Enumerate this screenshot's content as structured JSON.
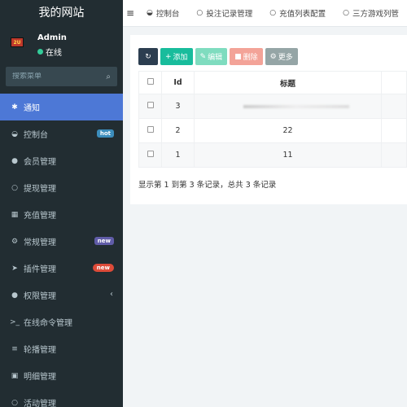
{
  "site": {
    "title": "我的网站"
  },
  "user": {
    "name": "Admin",
    "status": "在线",
    "avatar_text": "2U"
  },
  "search": {
    "placeholder": "搜索菜单"
  },
  "menu": [
    {
      "label": "通知",
      "icon": "asterisk-icon"
    },
    {
      "label": "控制台",
      "icon": "dashboard-icon",
      "badge": "hot"
    },
    {
      "label": "会员管理",
      "icon": "users-icon"
    },
    {
      "label": "提现管理",
      "icon": "circle-icon"
    },
    {
      "label": "充值管理",
      "icon": "grid-icon"
    },
    {
      "label": "常规管理",
      "icon": "cogs-icon",
      "badge": "new"
    },
    {
      "label": "插件管理",
      "icon": "rocket-icon",
      "badge": "new"
    },
    {
      "label": "权限管理",
      "icon": "group-icon"
    },
    {
      "label": "在线命令管理",
      "icon": "terminal-icon"
    },
    {
      "label": "轮播管理",
      "icon": "list-icon"
    },
    {
      "label": "明细管理",
      "icon": "calendar-icon"
    },
    {
      "label": "活动管理",
      "icon": "circle-icon"
    }
  ],
  "tabs": [
    {
      "label": "控制台"
    },
    {
      "label": "投注记录管理"
    },
    {
      "label": "充值列表配置"
    },
    {
      "label": "三方游戏列管"
    }
  ],
  "toolbar": {
    "add": "添加",
    "edit": "编辑",
    "delete": "删除",
    "more": "更多"
  },
  "table": {
    "headers": {
      "id": "Id",
      "title": "标题"
    },
    "rows": [
      {
        "id": "3",
        "title": ""
      },
      {
        "id": "2",
        "title": "22"
      },
      {
        "id": "1",
        "title": "11"
      }
    ]
  },
  "pagination": {
    "summary": "显示第 1 到第 3 条记录，总共 3 条记录"
  },
  "colors": {
    "sidebar": "#222d32",
    "active": "#4d78d6",
    "add": "#18bc9c"
  }
}
